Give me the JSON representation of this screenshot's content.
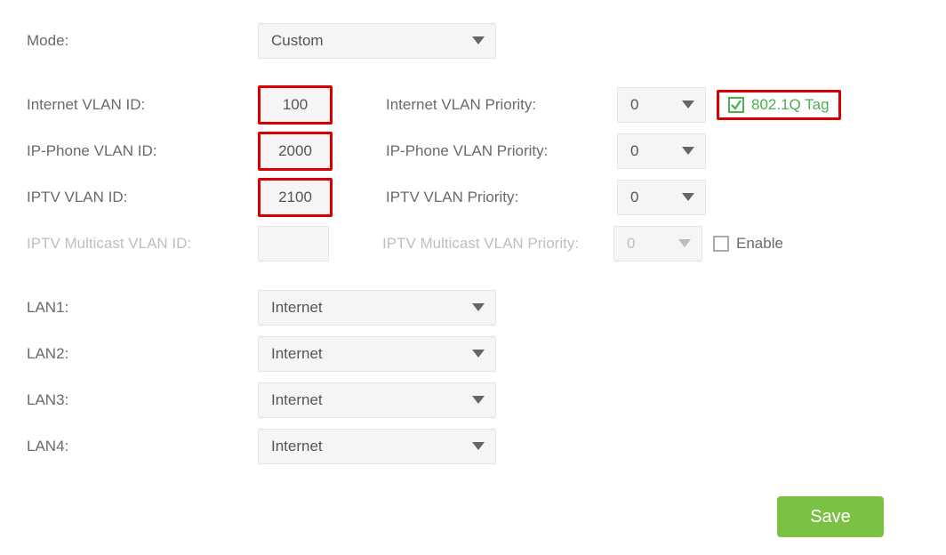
{
  "mode": {
    "label": "Mode:",
    "value": "Custom"
  },
  "internet_vlan": {
    "label": "Internet VLAN ID:",
    "value": "100",
    "prio_label": "Internet VLAN Priority:",
    "prio_value": "0",
    "tag_label": "802.1Q Tag",
    "tag_checked": true
  },
  "ipphone_vlan": {
    "label": "IP-Phone VLAN ID:",
    "value": "2000",
    "prio_label": "IP-Phone VLAN Priority:",
    "prio_value": "0"
  },
  "iptv_vlan": {
    "label": "IPTV VLAN ID:",
    "value": "2100",
    "prio_label": "IPTV VLAN Priority:",
    "prio_value": "0"
  },
  "iptv_mc_vlan": {
    "label": "IPTV Multicast VLAN ID:",
    "value": "",
    "prio_label": "IPTV Multicast VLAN Priority:",
    "prio_value": "0",
    "enable_label": "Enable",
    "enable_checked": false
  },
  "lan1": {
    "label": "LAN1:",
    "value": "Internet"
  },
  "lan2": {
    "label": "LAN2:",
    "value": "Internet"
  },
  "lan3": {
    "label": "LAN3:",
    "value": "Internet"
  },
  "lan4": {
    "label": "LAN4:",
    "value": "Internet"
  },
  "save_label": "Save"
}
